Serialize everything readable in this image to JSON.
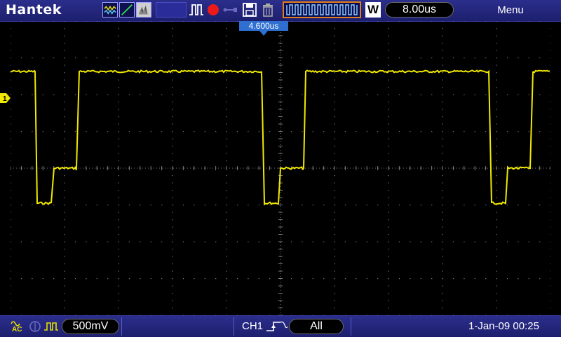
{
  "header": {
    "brand": "Hantek",
    "trigger_position": "4.600us",
    "timebase_mode_letter": "W",
    "timebase": "8.00us",
    "menu_label": "Menu"
  },
  "toolbar": {
    "icons": [
      "waveform-display-icon",
      "line-draw-icon",
      "persistence-icon",
      "blank-slot",
      "pulse-icon",
      "record-dot-icon",
      "usb-icon",
      "save-disk-icon",
      "trash-icon",
      "timebase-wave-icon"
    ]
  },
  "channel": {
    "marker": "1",
    "color": "#f0e800"
  },
  "footer": {
    "coupling": "AC",
    "volts_per_div": "500mV",
    "trigger_source": "CH1",
    "trigger_mode": "All",
    "date_time": "1-Jan-09 00:25"
  },
  "colors": {
    "bar_bg": "#22257a",
    "trace": "#f0e800",
    "grid": "#7a7a7a",
    "accent_orange": "#e0801a",
    "trigger_badge": "#2e6fd0"
  }
}
